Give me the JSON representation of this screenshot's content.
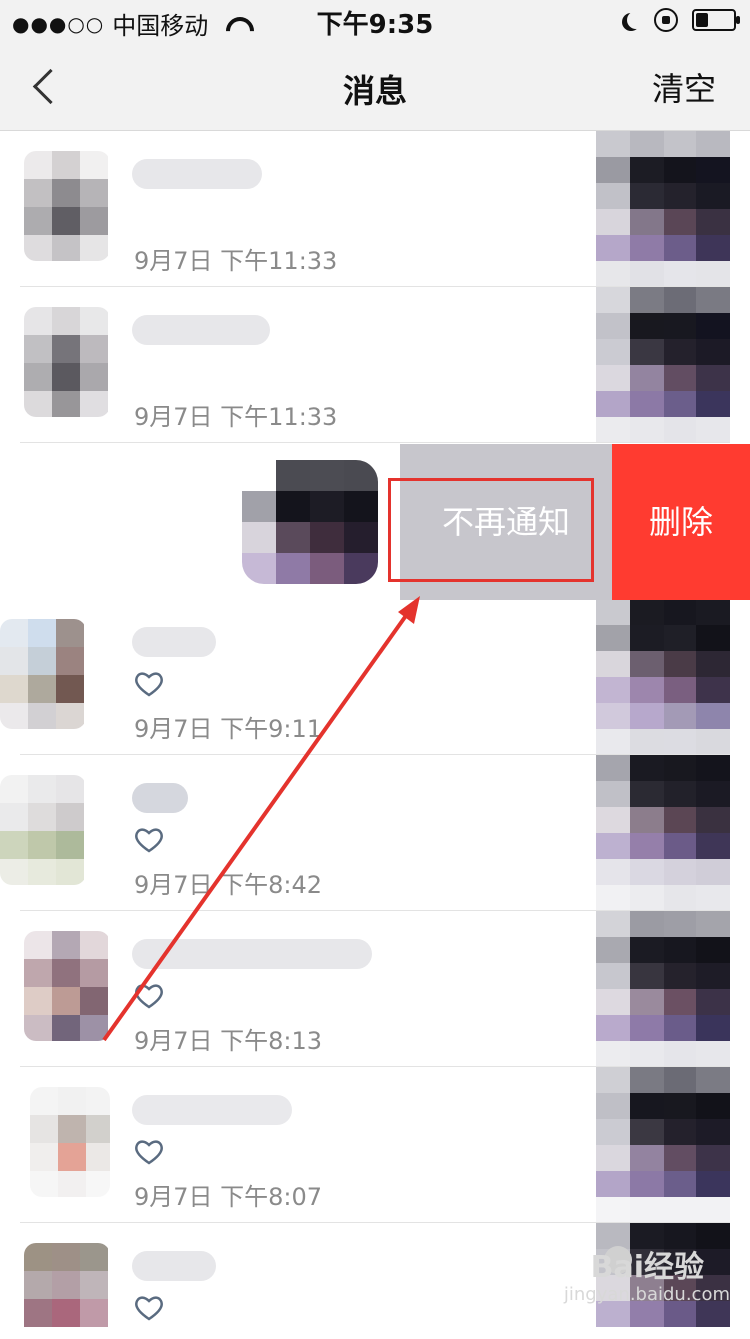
{
  "status_bar": {
    "signal_dots": "●●●○○",
    "carrier": "中国移动",
    "time": "下午9:35"
  },
  "nav": {
    "back_icon": "chevron-left-icon",
    "title": "消息",
    "clear_label": "清空"
  },
  "list": {
    "rows": [
      {
        "timestamp": "9月7日 下午11:33",
        "liked": false
      },
      {
        "timestamp": "9月7日 下午11:33",
        "liked": false
      },
      {
        "timestamp": "",
        "liked": false
      },
      {
        "timestamp": "9月7日 下午9:11",
        "liked": true
      },
      {
        "timestamp": "9月7日 下午8:42",
        "liked": true
      },
      {
        "timestamp": "9月7日 下午8:13",
        "liked": true
      },
      {
        "timestamp": "9月7日 下午8:07",
        "liked": true
      },
      {
        "timestamp": "",
        "liked": true
      }
    ],
    "swipe_actions": {
      "no_notify_label": "不再通知",
      "delete_label": "删除"
    }
  },
  "watermark": {
    "brand": "Bai经验",
    "url": "jingyan.baidu.com"
  },
  "colors": {
    "delete_red": "#ff3b30",
    "no_notify_gray": "#c7c6cc",
    "annotation_red": "#e4332d"
  }
}
